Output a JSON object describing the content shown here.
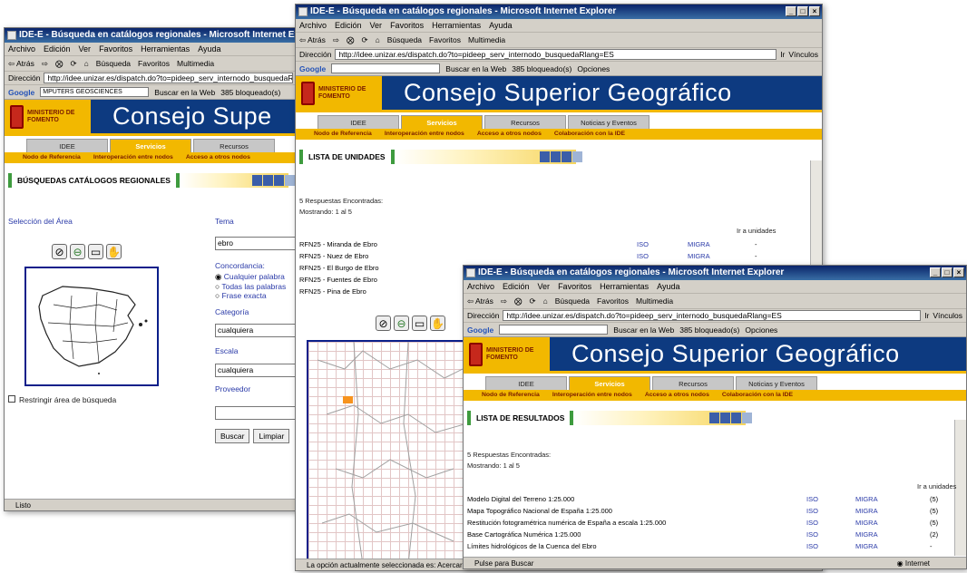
{
  "browser": {
    "menu": [
      "Archivo",
      "Edición",
      "Ver",
      "Favoritos",
      "Herramientas",
      "Ayuda"
    ],
    "toolbar": [
      "⇦ Atrás",
      "⇨",
      "⨂",
      "⟳",
      "⌂",
      "Búsqueda",
      "Favoritos",
      "Multimedia"
    ],
    "address_label": "Dirección",
    "go": "Ir",
    "links": "Vínculos",
    "google_label": "Google",
    "search_web": "Buscar en la Web",
    "blocked": "385 bloqueado(s)",
    "options": "Opciones"
  },
  "site": {
    "ministerio": "MINISTERIO DE FOMENTO",
    "title": "Consejo Superior Geográfico",
    "tabs": [
      "IDEE",
      "Servicios",
      "Recursos",
      "Noticias y Eventos"
    ],
    "subnav": [
      "Nodo de Referencia",
      "Interoperación entre nodos",
      "Acceso a otros nodos",
      "Colaboración con la IDE"
    ]
  },
  "win1": {
    "title": "IDE-E - Búsqueda en catálogos regionales - Microsoft Internet Explorer",
    "url": "http://idee.unizar.es/dispatch.do?to=pideep_serv_internodo_busquedaRlang=ES",
    "google_value": "MPUTERS GEOSCIENCES",
    "banner_title": "Consejo Supe",
    "section": "BÚSQUEDAS CATÁLOGOS REGIONALES",
    "area_label": "Selección del Área",
    "restrict": "Restringir área de búsqueda",
    "tema_label": "Tema",
    "tema_value": "ebro",
    "concordancia_label": "Concordancia:",
    "options": [
      "Cualquier palabra",
      "Todas las palabras",
      "Frase exacta"
    ],
    "categoria_label": "Categoría",
    "categoria_value": "cualquiera",
    "escala_label": "Escala",
    "escala_value": "cualquiera",
    "proveedor_label": "Proveedor",
    "buscar": "Buscar",
    "limpiar": "Limpiar",
    "status": "Listo"
  },
  "win2": {
    "title": "IDE-E - Búsqueda en catálogos regionales - Microsoft Internet Explorer",
    "url": "http://idee.unizar.es/dispatch.do?to=pideep_serv_internodo_busquedaRlang=ES",
    "section": "LISTA DE UNIDADES",
    "found": "5 Respuestas Encontradas:",
    "showing": "Mostrando:  1 al 5",
    "goto": "Ir a unidades",
    "rows": [
      {
        "name": "RFN25 - Miranda de Ebro",
        "iso": "ISO",
        "migra": "MIGRA",
        "u": "-"
      },
      {
        "name": "RFN25 - Nuez de Ebro",
        "iso": "ISO",
        "migra": "MIGRA",
        "u": "-"
      },
      {
        "name": "RFN25 - El Burgo de Ebro",
        "iso": "ISO",
        "migra": "MIGRA",
        "u": "-"
      },
      {
        "name": "RFN25 - Fuentes de Ebro",
        "iso": "",
        "migra": "",
        "u": ""
      },
      {
        "name": "RFN25 - Pina de Ebro",
        "iso": "",
        "migra": "",
        "u": ""
      }
    ],
    "status": "La opción actualmente seleccionada es: Acercar el mapa en torno al rectángulo marcado."
  },
  "win3": {
    "title": "IDE-E - Búsqueda en catálogos regionales - Microsoft Internet Explorer",
    "url": "http://idee.unizar.es/dispatch.do?to=pideep_serv_internodo_busquedaRlang=ES",
    "section": "LISTA DE RESULTADOS",
    "found": "5 Respuestas Encontradas:",
    "showing": "Mostrando:  1 al 5",
    "goto": "Ir a unidades",
    "rows": [
      {
        "name": "Modelo Digital del Terreno 1:25.000",
        "iso": "ISO",
        "migra": "MIGRA",
        "u": "(5)"
      },
      {
        "name": "Mapa Topográfico Nacional de España 1:25.000",
        "iso": "ISO",
        "migra": "MIGRA",
        "u": "(5)"
      },
      {
        "name": "Restitución fotogramétrica numérica de España a escala 1:25.000",
        "iso": "ISO",
        "migra": "MIGRA",
        "u": "(5)"
      },
      {
        "name": "Base Cartográfica Numérica 1:25.000",
        "iso": "ISO",
        "migra": "MIGRA",
        "u": "(2)"
      },
      {
        "name": "Límites hidrológicos de la Cuenca del Ebro",
        "iso": "ISO",
        "migra": "MIGRA",
        "u": "-"
      }
    ],
    "status": "Pulse para Buscar",
    "zone": "Internet"
  },
  "colors": {
    "navy": "#0d3a80",
    "gold": "#f2b800",
    "green": "#3e9b3e",
    "link": "#2a3aa8"
  }
}
